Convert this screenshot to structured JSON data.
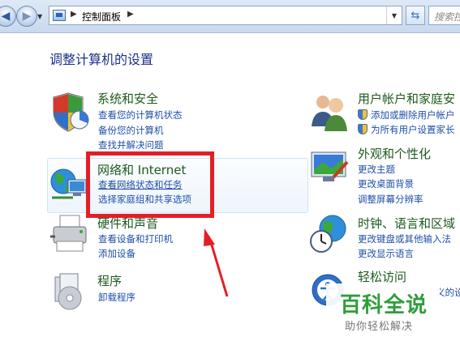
{
  "address_bar": {
    "breadcrumb": "控制面板",
    "search_placeholder": "搜索控"
  },
  "main": {
    "page_title": "调整计算机的设置",
    "categories_left": [
      {
        "title": "系统和安全",
        "icon": "shield-pie-icon",
        "links": [
          "查看您的计算机状态",
          "备份您的计算机",
          "查找并解决问题"
        ]
      },
      {
        "title": "网络和 Internet",
        "icon": "network-globe-icon",
        "links": [
          "查看网络状态和任务",
          "选择家庭组和共享选项"
        ]
      },
      {
        "title": "硬件和声音",
        "icon": "printer-icon",
        "links": [
          "查看设备和打印机",
          "添加设备"
        ]
      },
      {
        "title": "程序",
        "icon": "programs-icon",
        "links": [
          "卸载程序"
        ]
      }
    ],
    "categories_right": [
      {
        "title": "用户帐户和家庭安",
        "icon": "users-icon",
        "links": [
          "添加或删除用户帐户",
          "为所有用户设置家长"
        ]
      },
      {
        "title": "外观和个性化",
        "icon": "appearance-icon",
        "links": [
          "更改主题",
          "更改桌面背景",
          "调整屏幕分辨率"
        ]
      },
      {
        "title": "时钟、语言和区域",
        "icon": "clock-globe-icon",
        "links": [
          "更改键盘或其他输入法",
          "更改显示语言"
        ]
      },
      {
        "title": "轻松访问",
        "icon": "ease-of-access-icon",
        "links": [
          "义的设"
        ]
      }
    ]
  },
  "watermark": {
    "main": "百科全说",
    "sub": "助你轻松解决"
  },
  "colors": {
    "annotation_red": "#e41e26",
    "link_blue": "#1e4fa8",
    "category_green": "#1e5a1e"
  }
}
